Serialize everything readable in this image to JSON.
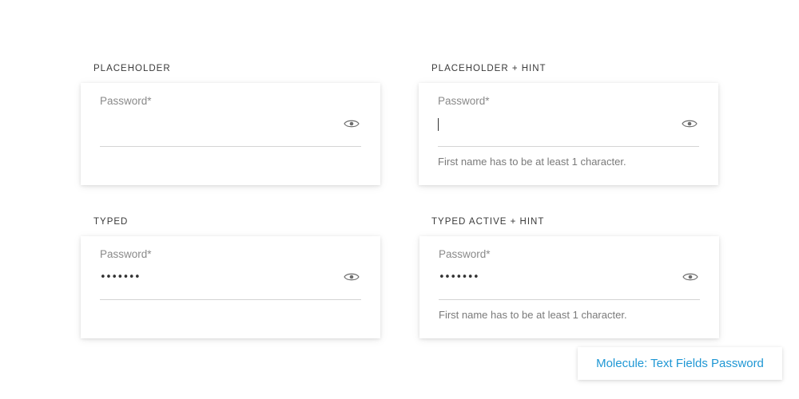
{
  "sections": [
    {
      "title": "PLACEHOLDER",
      "label": "Password*",
      "value": "",
      "hint": ""
    },
    {
      "title": "PLACEHOLDER + HINT",
      "label": "Password*",
      "value": "",
      "hint": "First name has to be at least 1 character."
    },
    {
      "title": "TYPED",
      "label": "Password*",
      "value": "•••••••",
      "hint": ""
    },
    {
      "title": "TYPED ACTIVE + HINT",
      "label": "Password*",
      "value": "•••••••",
      "hint": "First name has to be at least 1 character."
    }
  ],
  "footer_tag": "Molecule: Text Fields Password",
  "icons": {
    "toggle_visibility": "eye-icon"
  },
  "colors": {
    "label": "#8a8a8a",
    "hint": "#7a7a7a",
    "underline": "#d4d4d4",
    "accent": "#1f97d4"
  }
}
